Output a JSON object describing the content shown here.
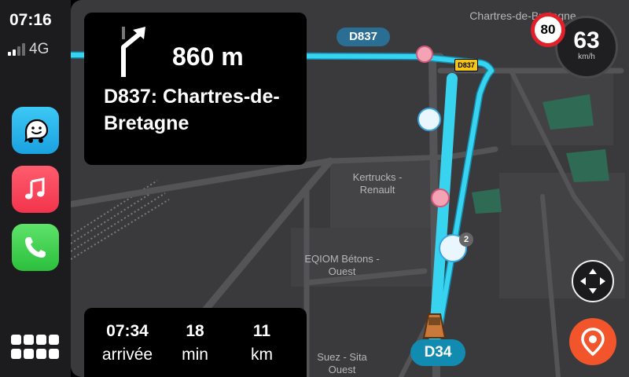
{
  "status_bar": {
    "time": "07:16",
    "network": "4G"
  },
  "dock": {
    "apps": [
      {
        "name": "Waze",
        "icon": "waze-icon"
      },
      {
        "name": "Music",
        "icon": "music-note-icon"
      },
      {
        "name": "Phone",
        "icon": "phone-icon"
      }
    ],
    "home_icon": "app-grid-icon"
  },
  "navigation": {
    "maneuver_icon": "turn-right-arrow-icon",
    "distance": "860 m",
    "street": "D837: Chartres-de-Bretagne"
  },
  "trip": {
    "arrival_time": "07:34",
    "arrival_label": "arrivée",
    "duration": "18",
    "duration_label": "min",
    "distance": "11",
    "distance_label": "km"
  },
  "map": {
    "labels": {
      "city": "Chartres-de-Bretagne",
      "poi_1": "Kertrucks - Renault",
      "poi_2": "EQIOM Bétons - Ouest",
      "poi_3": "Suez - Sita Ouest"
    },
    "road_pill_top": "D837",
    "road_shield": "D837",
    "current_road": "D34",
    "report_count": "2"
  },
  "speedometer": {
    "speed": "63",
    "unit": "km/h",
    "limit": "80"
  },
  "colors": {
    "route": "#38d3ee",
    "map_background": "#3a3a3c",
    "road": "#545457",
    "park": "#2f6a55",
    "limit_ring": "#e0202a",
    "report_button": "#f2552c"
  }
}
